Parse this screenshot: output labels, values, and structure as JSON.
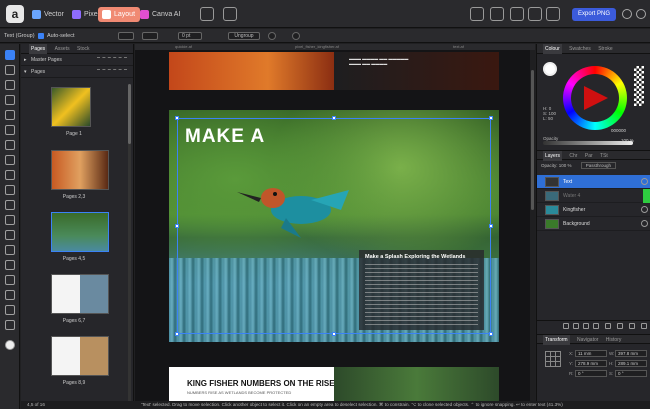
{
  "app": {
    "personas": [
      "Vector",
      "Pixel",
      "Layout",
      "Canva AI"
    ],
    "active_persona": "Layout",
    "export_label": "Export PNG"
  },
  "context_toolbar": {
    "selection": "Text (Group)",
    "auto_select": "Auto-select",
    "stroke_width": "0 pt",
    "ungroup": "Ungroup"
  },
  "doc_tabs": [
    "quickie.af",
    "pixel_fisher_kingfisher.af",
    "text.af"
  ],
  "pages_panel": {
    "tabs": [
      "Pages",
      "Assets",
      "Stock"
    ],
    "master_pages": "Master Pages",
    "pages_header": "Pages",
    "thumbnails": [
      "Page 1",
      "Pages 2,3",
      "Pages 4,5",
      "Pages 6,7",
      "Pages 8,9"
    ],
    "footer": "4,5 of 16"
  },
  "canvas": {
    "spread_headline": "MAKE A",
    "article_heading": "Make a Splash Exploring the Wetlands",
    "next_title": "KING FISHER NUMBERS ON THE RISE",
    "next_subtitle": "NUMBERS RISE AS WETLANDS BECOME PROTECTED"
  },
  "status_bar": {
    "page": "4,5 of 16",
    "message": "'Text' selected. Drag to move selection. Click another object to select it. Click on an empty area to deselect selection. ⌘ to constrain. ⌥ to clone selected objects. ⌃ to ignore snapping. ↩ to enter text (41.3%)"
  },
  "colour_panel": {
    "tabs": [
      "Colour",
      "Swatches",
      "Stroke"
    ],
    "hsl": [
      "H: 0",
      "S: 100",
      "L: 50"
    ],
    "hex": "000000",
    "opacity_label": "Opacity",
    "opacity_value": "100 %"
  },
  "layers_panel": {
    "tabs": [
      "Layers",
      "Chr",
      "Par",
      "TSt"
    ],
    "opacity": "Opacity: 100 %",
    "blend": "Passthrough",
    "layers": [
      {
        "name": "Text",
        "selected": true
      },
      {
        "name": "Water 4",
        "selected": false
      },
      {
        "name": "Kingfisher",
        "selected": false
      },
      {
        "name": "Background",
        "selected": false
      }
    ]
  },
  "transform_panel": {
    "tabs": [
      "Transform",
      "Navigator",
      "History"
    ],
    "x": "11 mm",
    "y": "278.9 mm",
    "w": "397.8 mm",
    "h": "289.1 mm",
    "r": "0 °",
    "s": "0 °"
  },
  "colors": {
    "accent": "#3b82f6",
    "persona_active": "#f08a73",
    "export": "#3b5bdb"
  }
}
